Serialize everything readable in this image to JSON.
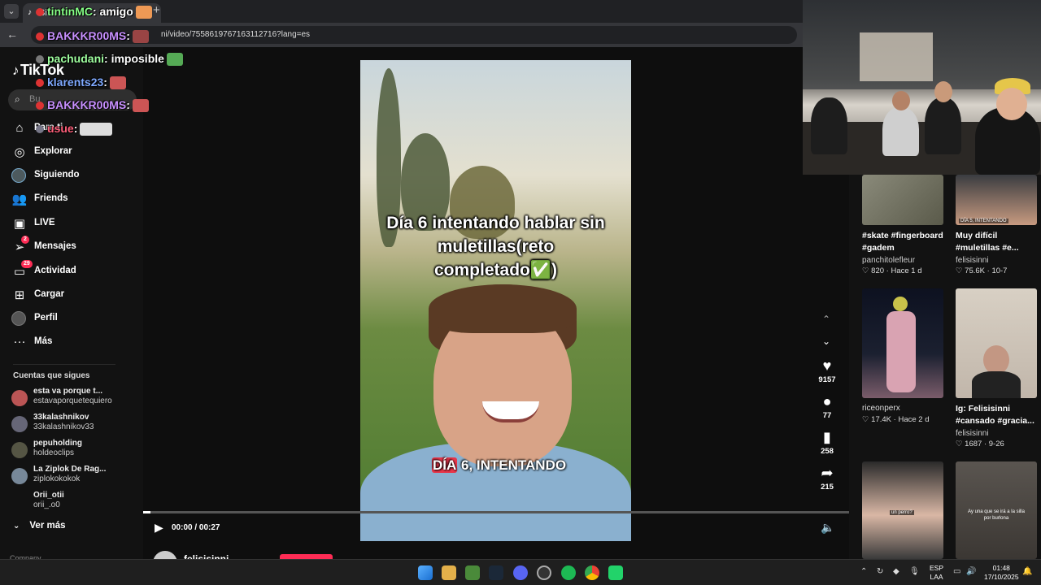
{
  "browser": {
    "tab_title": "Si",
    "url": "ni/video/7558619767163112716?lang=es"
  },
  "chat": [
    {
      "user": "tintinMC",
      "message": "amigo"
    },
    {
      "user": "BAKKKR00MS",
      "message": ""
    },
    {
      "user": "pachudani",
      "message": "imposible"
    },
    {
      "user": "klarents23",
      "message": ""
    },
    {
      "user": "BAKKKR00MS",
      "message": ""
    },
    {
      "user": "usue",
      "message": ""
    }
  ],
  "sidebar": {
    "logo": "TikTok",
    "search_placeholder": "Bu",
    "nav": [
      {
        "label": "Para ti",
        "icon": "home-icon"
      },
      {
        "label": "Explorar",
        "icon": "compass-icon"
      },
      {
        "label": "Siguiendo",
        "icon": "avatar"
      },
      {
        "label": "Friends",
        "icon": "friends-icon"
      },
      {
        "label": "LIVE",
        "icon": "live-icon"
      },
      {
        "label": "Mensajes",
        "icon": "send-icon",
        "badge": "2"
      },
      {
        "label": "Actividad",
        "icon": "inbox-icon",
        "badge": "29"
      },
      {
        "label": "Cargar",
        "icon": "plus-square-icon"
      },
      {
        "label": "Perfil",
        "icon": "avatar"
      },
      {
        "label": "Más",
        "icon": "more-icon"
      }
    ],
    "following_header": "Cuentas que sigues",
    "following": [
      {
        "name": "esta va porque t...",
        "handle": "estavaporquetequiero"
      },
      {
        "name": "33kalashnikov",
        "handle": "33kalashnikov33"
      },
      {
        "name": "pepuholding",
        "handle": "holdeoclips"
      },
      {
        "name": "La Ziplok De Rag...",
        "handle": "ziplokokokok"
      },
      {
        "name": "Orii_otii",
        "handle": "orii_.o0"
      }
    ],
    "see_more": "Ver más",
    "company": "Company"
  },
  "video": {
    "caption": "Día 6 intentando hablar sin muletillas(reto completado✅)",
    "subtitle_highlight": "DÍA",
    "subtitle_rest": " 6, INTENTANDO",
    "time": "00:00 / 00:27",
    "progress": 0.01,
    "likes": "9157",
    "comments": "77",
    "saves": "258",
    "shares": "215",
    "author": "felisisinni"
  },
  "related": [
    {
      "title": "#skate #fingerboard #gadem",
      "author": "panchitolefleur",
      "likes": "820",
      "time": "Hace 1 d"
    },
    {
      "title": "Muy difícil #muletillas #e...",
      "author": "felisisinni",
      "likes": "75.6K",
      "time": "10-7",
      "tag": "DÍA 5, INTENTANDO"
    },
    {
      "title": "",
      "author": "riceonperx",
      "likes": "17.4K",
      "time": "Hace 2 d"
    },
    {
      "title": "Ig: Felisisinni #cansado #gracia...",
      "author": "felisisinni",
      "likes": "1687",
      "time": "9-26"
    },
    {
      "title": "",
      "author": "",
      "likes": "",
      "time": "",
      "tag": "un perro?"
    },
    {
      "title": "",
      "author": "",
      "likes": "",
      "time": "",
      "tag": "Ay una que se irá a la silla por burlona"
    }
  ],
  "taskbar": {
    "lang_top": "ESP",
    "lang_bottom": "LAA",
    "time": "01:48",
    "date": "17/10/2025"
  },
  "colors": {
    "accent": "#fe2c55",
    "background": "#121212"
  }
}
